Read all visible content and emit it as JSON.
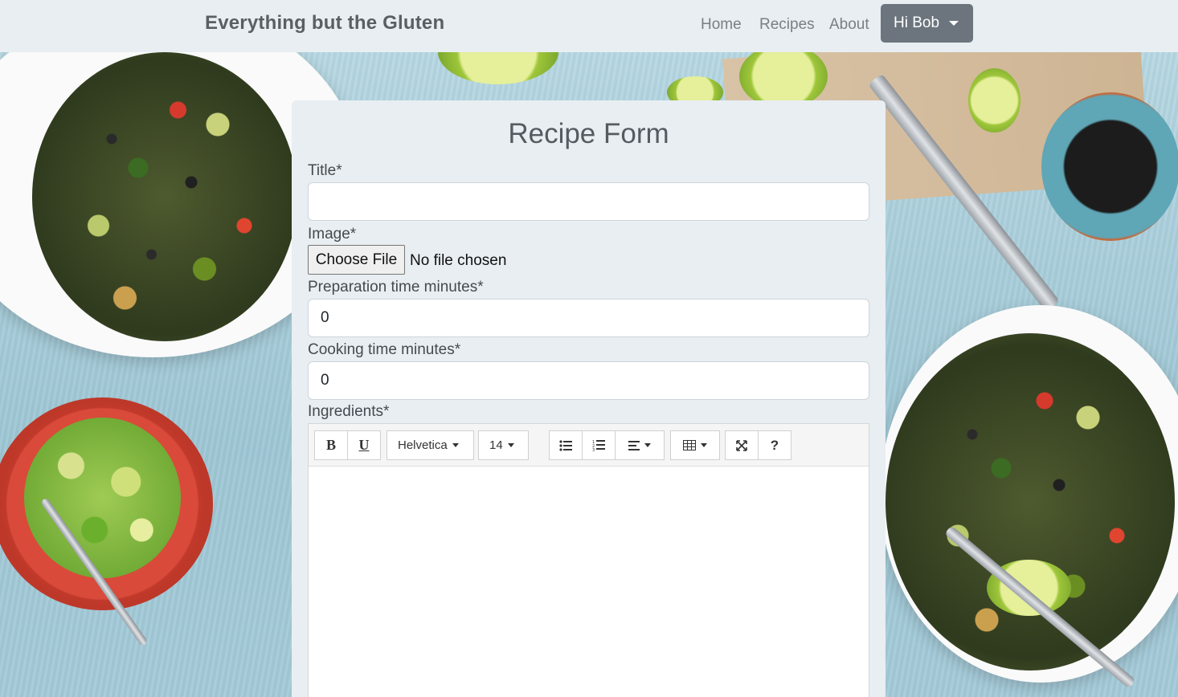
{
  "navbar": {
    "brand": "Everything but the Gluten",
    "links": [
      "Home",
      "Recipes",
      "About"
    ],
    "user_menu": "Hi Bob"
  },
  "form": {
    "heading": "Recipe Form",
    "title_label": "Title*",
    "title_value": "",
    "image_label": "Image*",
    "file_button": "Choose File",
    "file_status": "No file chosen",
    "prep_label": "Preparation time minutes*",
    "prep_value": "0",
    "cook_label": "Cooking time minutes*",
    "cook_value": "0",
    "ingredients_label": "Ingredients*"
  },
  "editor": {
    "bold": "B",
    "underline": "U",
    "font_family": "Helvetica",
    "font_size": "14",
    "help": "?",
    "icons": [
      "bold-icon",
      "underline-icon",
      "unordered-list-icon",
      "ordered-list-icon",
      "align-icon",
      "table-icon",
      "fullscreen-icon",
      "help-icon"
    ]
  }
}
